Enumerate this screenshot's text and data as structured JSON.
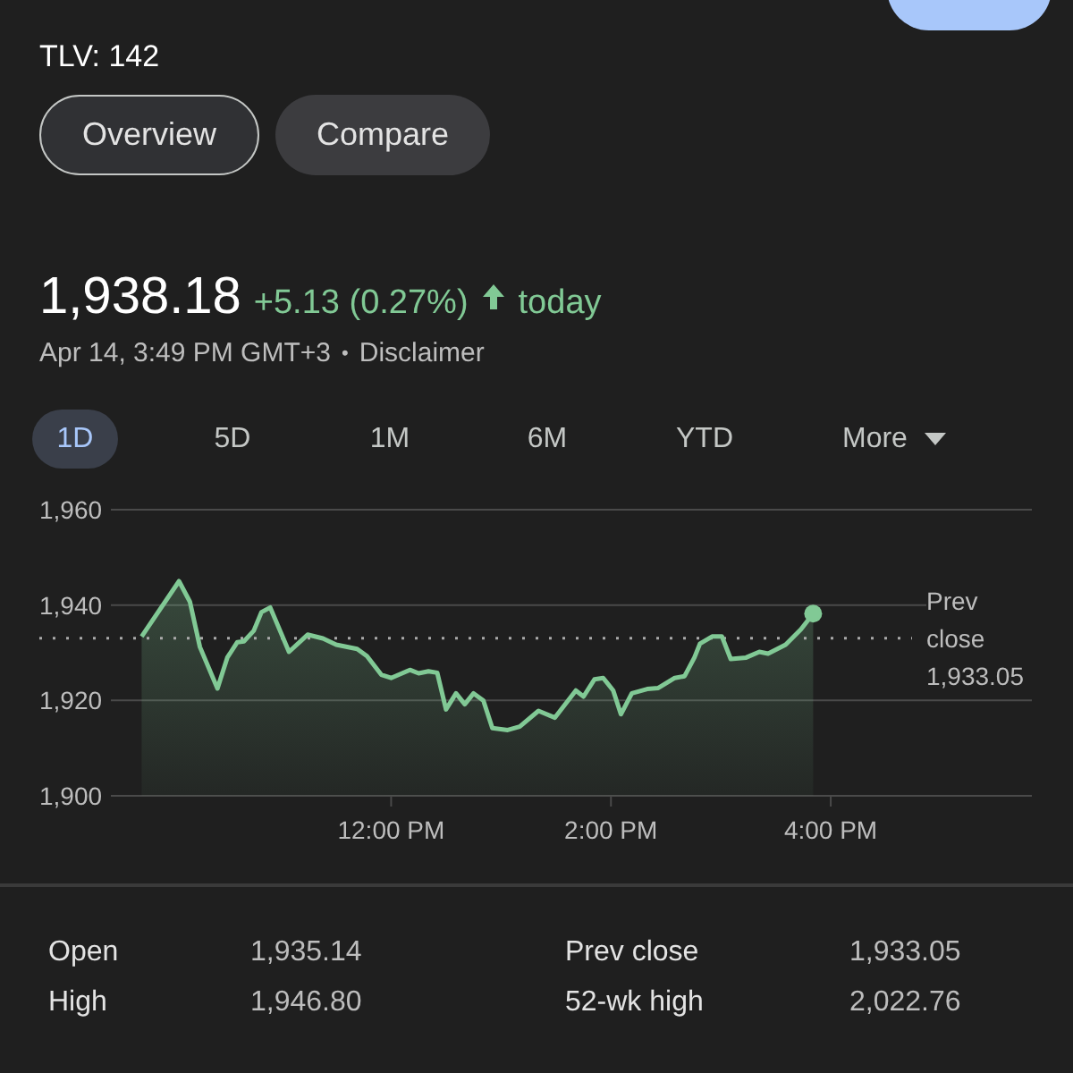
{
  "header": {
    "ticker": "TLV: 142"
  },
  "view_tabs": [
    {
      "label": "Overview",
      "selected": true
    },
    {
      "label": "Compare",
      "selected": false
    }
  ],
  "quote": {
    "price": "1,938.18",
    "change": "+5.13 (0.27%)",
    "period": "today",
    "timestamp": "Apr 14, 3:49 PM GMT+3",
    "separator": "•",
    "disclaimer": "Disclaimer"
  },
  "ranges": [
    {
      "label": "1D",
      "selected": true,
      "kind": "range"
    },
    {
      "label": "5D",
      "selected": false,
      "kind": "range"
    },
    {
      "label": "1M",
      "selected": false,
      "kind": "range"
    },
    {
      "label": "6M",
      "selected": false,
      "kind": "range"
    },
    {
      "label": "YTD",
      "selected": false,
      "kind": "range"
    },
    {
      "label": "More",
      "selected": false,
      "kind": "dropdown"
    }
  ],
  "chart": {
    "chart_data": {
      "type": "area",
      "x": [
        9.73,
        10.07,
        10.17,
        10.26,
        10.42,
        10.51,
        10.6,
        10.66,
        10.75,
        10.82,
        10.9,
        11.07,
        11.24,
        11.38,
        11.5,
        11.69,
        11.78,
        11.91,
        12,
        12.17,
        12.25,
        12.34,
        12.42,
        12.5,
        12.59,
        12.67,
        12.75,
        12.84,
        12.92,
        13.06,
        13.17,
        13.34,
        13.49,
        13.68,
        13.75,
        13.85,
        13.93,
        14.02,
        14.09,
        14.19,
        14.33,
        14.43,
        14.58,
        14.67,
        14.76,
        14.81,
        14.92,
        15.01,
        15.09,
        15.23,
        15.35,
        15.43,
        15.59,
        15.73,
        15.84
      ],
      "series": [
        {
          "color": "#81c995",
          "values": [
            1933.4,
            1945.0,
            1940.7,
            1931.2,
            1922.5,
            1929.0,
            1932.2,
            1932.4,
            1934.6,
            1938.5,
            1939.5,
            1930.2,
            1933.8,
            1933.0,
            1931.7,
            1930.8,
            1929.3,
            1925.4,
            1924.7,
            1926.4,
            1925.7,
            1926.1,
            1925.8,
            1918.1,
            1921.5,
            1919.2,
            1921.5,
            1920.0,
            1914.2,
            1913.8,
            1914.5,
            1917.8,
            1916.4,
            1922.1,
            1920.8,
            1924.4,
            1924.7,
            1922.1,
            1917.1,
            1921.5,
            1922.4,
            1922.6,
            1924.7,
            1925.1,
            1929.0,
            1931.9,
            1933.4,
            1933.4,
            1928.7,
            1929.0,
            1930.2,
            1929.8,
            1931.7,
            1934.9,
            1938.2
          ]
        }
      ],
      "xlim": [
        9.45,
        17.83
      ],
      "ylim": [
        1900,
        1960
      ],
      "xticks": [
        {
          "value": 12,
          "label": "12:00 PM"
        },
        {
          "value": 14,
          "label": "2:00 PM"
        },
        {
          "value": 16,
          "label": "4:00 PM"
        }
      ],
      "yticks": [
        {
          "value": 1900,
          "label": "1,900"
        },
        {
          "value": 1920,
          "label": "1,920"
        },
        {
          "value": 1940,
          "label": "1,940"
        },
        {
          "value": 1960,
          "label": "1,960"
        }
      ],
      "ref_lines": [
        {
          "axis": "y",
          "value": 1933.05,
          "label": "Prev close 1,933.05"
        }
      ]
    }
  },
  "stats": [
    {
      "label": "Open",
      "value": "1,935.14"
    },
    {
      "label": "Prev close",
      "value": "1,933.05"
    },
    {
      "label": "High",
      "value": "1,946.80"
    },
    {
      "label": "52-wk high",
      "value": "2,022.76"
    }
  ]
}
